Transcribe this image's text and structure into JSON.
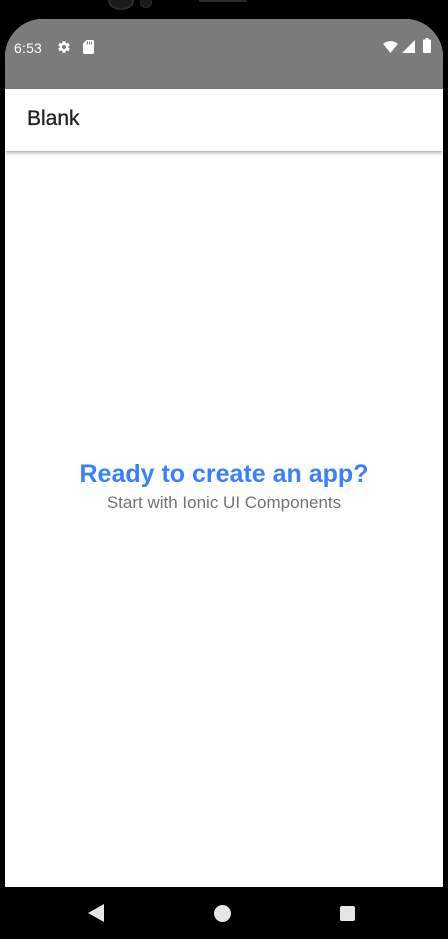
{
  "status_bar": {
    "time": "6:53",
    "icons": [
      "gear-icon",
      "sd-card-icon",
      "wifi-icon",
      "signal-icon",
      "battery-icon"
    ],
    "background": "#7b7b7b"
  },
  "header": {
    "title": "Blank"
  },
  "main": {
    "title": "Ready to create an app?",
    "subtitle": "Start with Ionic UI Components",
    "accent_color": "#3880ff"
  },
  "nav_bar": {
    "buttons": [
      "back-icon",
      "home-icon",
      "recents-icon"
    ]
  }
}
